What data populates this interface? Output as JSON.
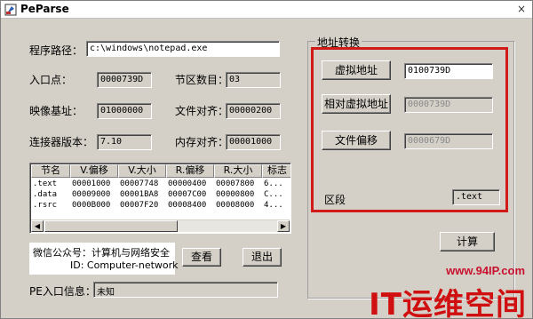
{
  "window": {
    "title": "PeParse",
    "close_glyph": "×",
    "app_icon": "app-icon"
  },
  "path": {
    "label": "程序路径：",
    "value": "c:\\windows\\notepad.exe"
  },
  "entry": {
    "label": "入口点：",
    "value": "0000739D"
  },
  "sections_count": {
    "label": "节区数目：",
    "value": "03"
  },
  "image_base": {
    "label": "映像基址：",
    "value": "01000000"
  },
  "file_align": {
    "label": "文件对齐：",
    "value": "00000200"
  },
  "linker": {
    "label": "连接器版本：",
    "value": "7.10"
  },
  "mem_align": {
    "label": "内存对齐：",
    "value": "00001000"
  },
  "section_table": {
    "columns": [
      "节名",
      "V.偏移",
      "V.大小",
      "R.偏移",
      "R.大小",
      "标志"
    ],
    "rows": [
      [
        ".text",
        "00001000",
        "00007748",
        "00000400",
        "00007800",
        "6..."
      ],
      [
        ".data",
        "00009000",
        "00001BA8",
        "00007C00",
        "00000800",
        "C..."
      ],
      [
        ".rsrc",
        "0000B000",
        "00007F20",
        "00008400",
        "00008000",
        "4..."
      ]
    ]
  },
  "info": {
    "line1": "微信公众号：计算机与网络安全",
    "line2": "ID: Computer-network"
  },
  "buttons": {
    "view": "查看",
    "exit": "退出",
    "calc": "计算"
  },
  "pe_entry_info": {
    "label": "PE入口信息：",
    "value": "未知"
  },
  "addr_convert": {
    "group_title": "地址转换",
    "va": {
      "label": "虚拟地址",
      "value": "0100739D"
    },
    "rva": {
      "label": "相对虚拟地址",
      "value": "0000739D"
    },
    "file_offset": {
      "label": "文件偏移",
      "value": "0000679D"
    },
    "section": {
      "label": "区段",
      "value": ".text"
    }
  },
  "watermark": {
    "url": "www.94IP.com",
    "brand": "IT运维空间"
  },
  "colors": {
    "highlight_border": "#d11a1a",
    "watermark": "#d01010"
  }
}
